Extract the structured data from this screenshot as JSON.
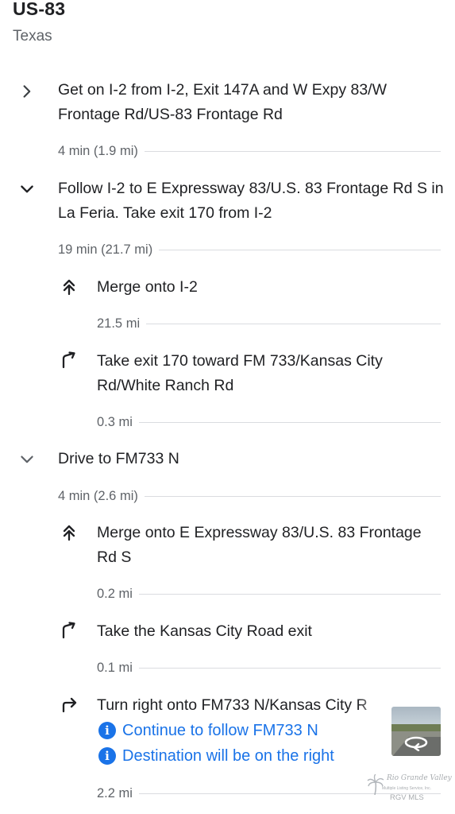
{
  "header": {
    "title": "US-83",
    "subtitle": "Texas"
  },
  "steps": [
    {
      "icon": "chevron-right-icon",
      "expanded": false,
      "text": "Get on I-2 from I-2, Exit 147A and W Expy 83/W Frontage Rd/US-83 Frontage Rd",
      "summary": "4 min (1.9 mi)"
    },
    {
      "icon": "chevron-down-icon",
      "expanded": true,
      "text": "Follow I-2 to E Expressway 83/U.S. 83 Frontage Rd S in La Feria. Take exit 170 from I-2",
      "summary": "19 min (21.7 mi)",
      "substeps": [
        {
          "icon": "merge-icon",
          "text": "Merge onto I-2",
          "distance": "21.5 mi"
        },
        {
          "icon": "slight-right-icon",
          "text": "Take exit 170 toward FM 733/Kansas City Rd/White Ranch Rd",
          "distance": "0.3 mi"
        }
      ]
    },
    {
      "icon": "chevron-down-icon",
      "expanded": true,
      "text": "Drive to FM733 N",
      "summary": "4 min (2.6 mi)",
      "substeps": [
        {
          "icon": "merge-icon",
          "text": "Merge onto E Expressway 83/U.S. 83 Frontage Rd S",
          "distance": "0.2 mi"
        },
        {
          "icon": "slight-right-icon",
          "text": "Take the Kansas City Road exit",
          "distance": "0.1 mi"
        },
        {
          "icon": "turn-right-icon",
          "text": "Turn right onto FM733 N/Kansas City R",
          "notes": [
            "Continue to follow FM733 N",
            "Destination will be on the right"
          ],
          "distance": "2.2 mi"
        }
      ]
    }
  ],
  "street_view_thumbnail": {
    "icon": "360-view-icon"
  },
  "watermark": {
    "script": "Rio Grande Valley",
    "small": "Multiple Listing Service, Inc.",
    "label": "RGV MLS"
  },
  "colors": {
    "text": "#202124",
    "secondary": "#5f6368",
    "divider": "#dadce0",
    "accent": "#1a73e8"
  }
}
